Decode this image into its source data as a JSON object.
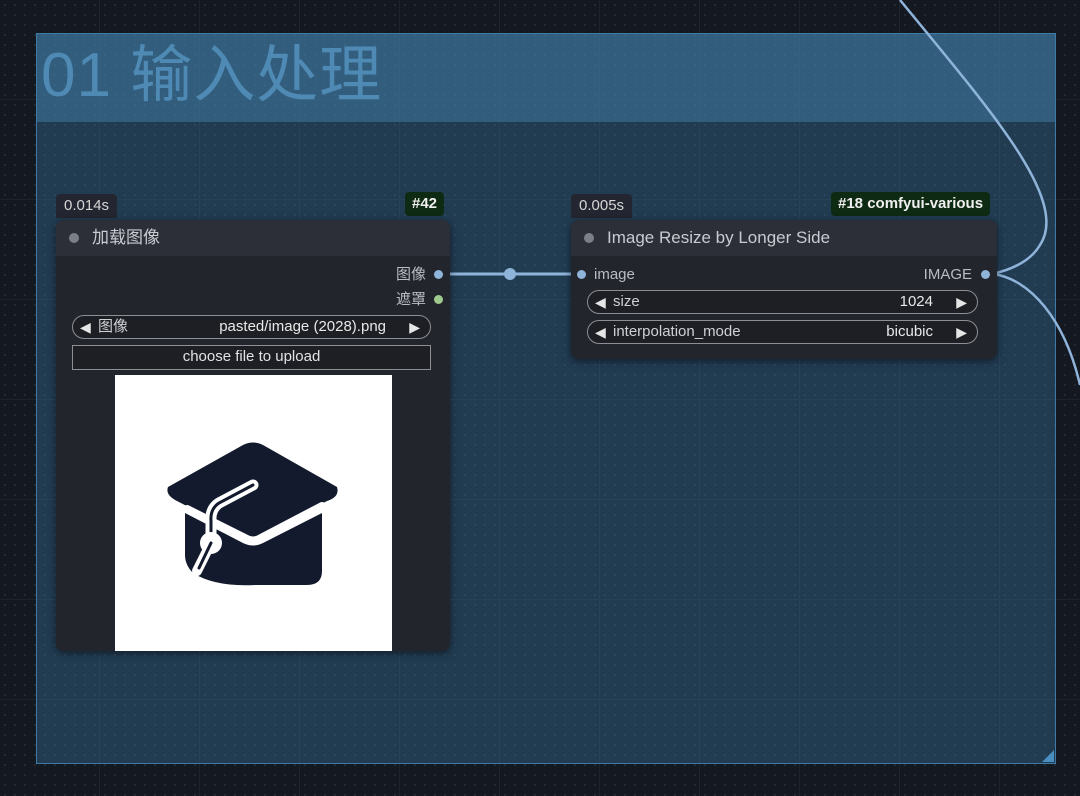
{
  "group": {
    "title": "01 输入处理"
  },
  "load_image_node": {
    "time": "0.014s",
    "id": "#42",
    "title": "加载图像",
    "outputs": [
      "图像",
      "遮罩"
    ],
    "image_widget": {
      "name": "图像",
      "value": "pasted/image (2028).png"
    },
    "upload_label": "choose file to upload",
    "preview_icon": "graduation-cap-icon"
  },
  "resize_node": {
    "time": "0.005s",
    "id": "#18 comfyui-various",
    "title": "Image Resize by Longer Side",
    "input": "image",
    "output": "IMAGE",
    "widgets": [
      {
        "name": "size",
        "value": "1024"
      },
      {
        "name": "interpolation_mode",
        "value": "bicubic"
      }
    ]
  },
  "arrows": {
    "left": "◀",
    "right": "▶"
  },
  "colors": {
    "link": "#8fb4da",
    "image_slot": "#8fb4da",
    "mask_slot": "#9fca8d",
    "group_border": "#3d7aa6",
    "id_badge_bg": "#0f2a12"
  }
}
